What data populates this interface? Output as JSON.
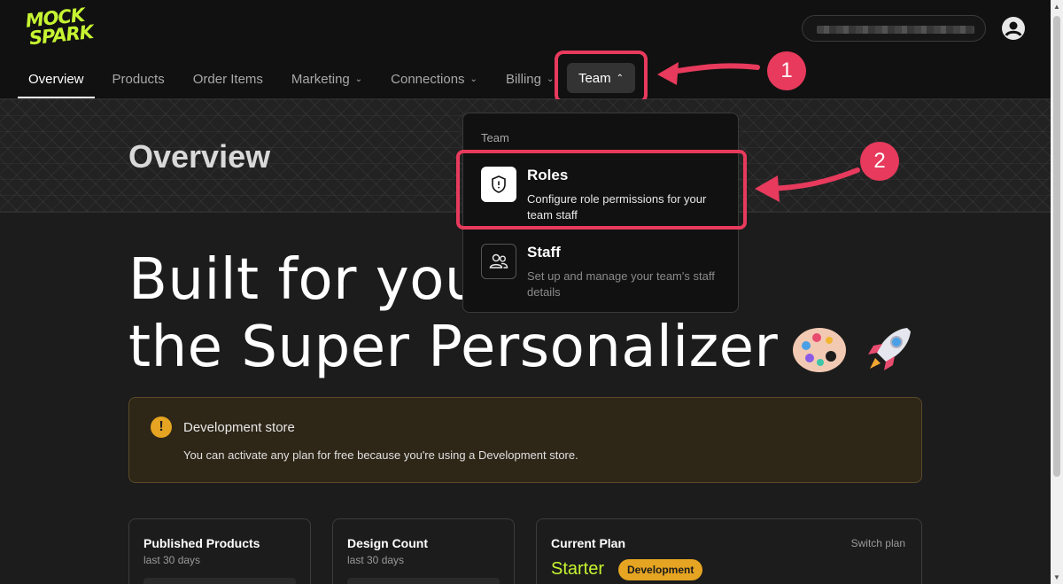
{
  "app": {
    "logo_line1": "MOCK",
    "logo_line2": "SPARK"
  },
  "nav": {
    "items": [
      {
        "label": "Overview",
        "active": true
      },
      {
        "label": "Products"
      },
      {
        "label": "Order Items"
      },
      {
        "label": "Marketing",
        "has_menu": true
      },
      {
        "label": "Connections",
        "has_menu": true
      },
      {
        "label": "Billing",
        "has_menu": true
      }
    ],
    "team_label": "Team"
  },
  "page": {
    "title": "Overview",
    "hero_line1": "Built for you",
    "hero_line2": "the Super Personalizer"
  },
  "notice": {
    "title": "Development store",
    "body": "You can activate any plan for free because you're using a Development store."
  },
  "cards": {
    "published": {
      "title": "Published Products",
      "subtitle": "last 30 days"
    },
    "design": {
      "title": "Design Count",
      "subtitle": "last 30 days"
    },
    "plan": {
      "title": "Current Plan",
      "switch_label": "Switch plan",
      "plan_name": "Starter",
      "badge": "Development"
    }
  },
  "dropdown": {
    "header": "Team",
    "items": [
      {
        "title": "Roles",
        "description": "Configure role permissions for your team staff",
        "icon": "shield-icon"
      },
      {
        "title": "Staff",
        "description": "Set up and manage your team's staff details",
        "icon": "users-icon"
      }
    ]
  },
  "annotations": {
    "step1": "1",
    "step2": "2"
  },
  "colors": {
    "accent_lime": "#c6f432",
    "highlight_red": "#e73a5c",
    "warning": "#e5a421"
  }
}
